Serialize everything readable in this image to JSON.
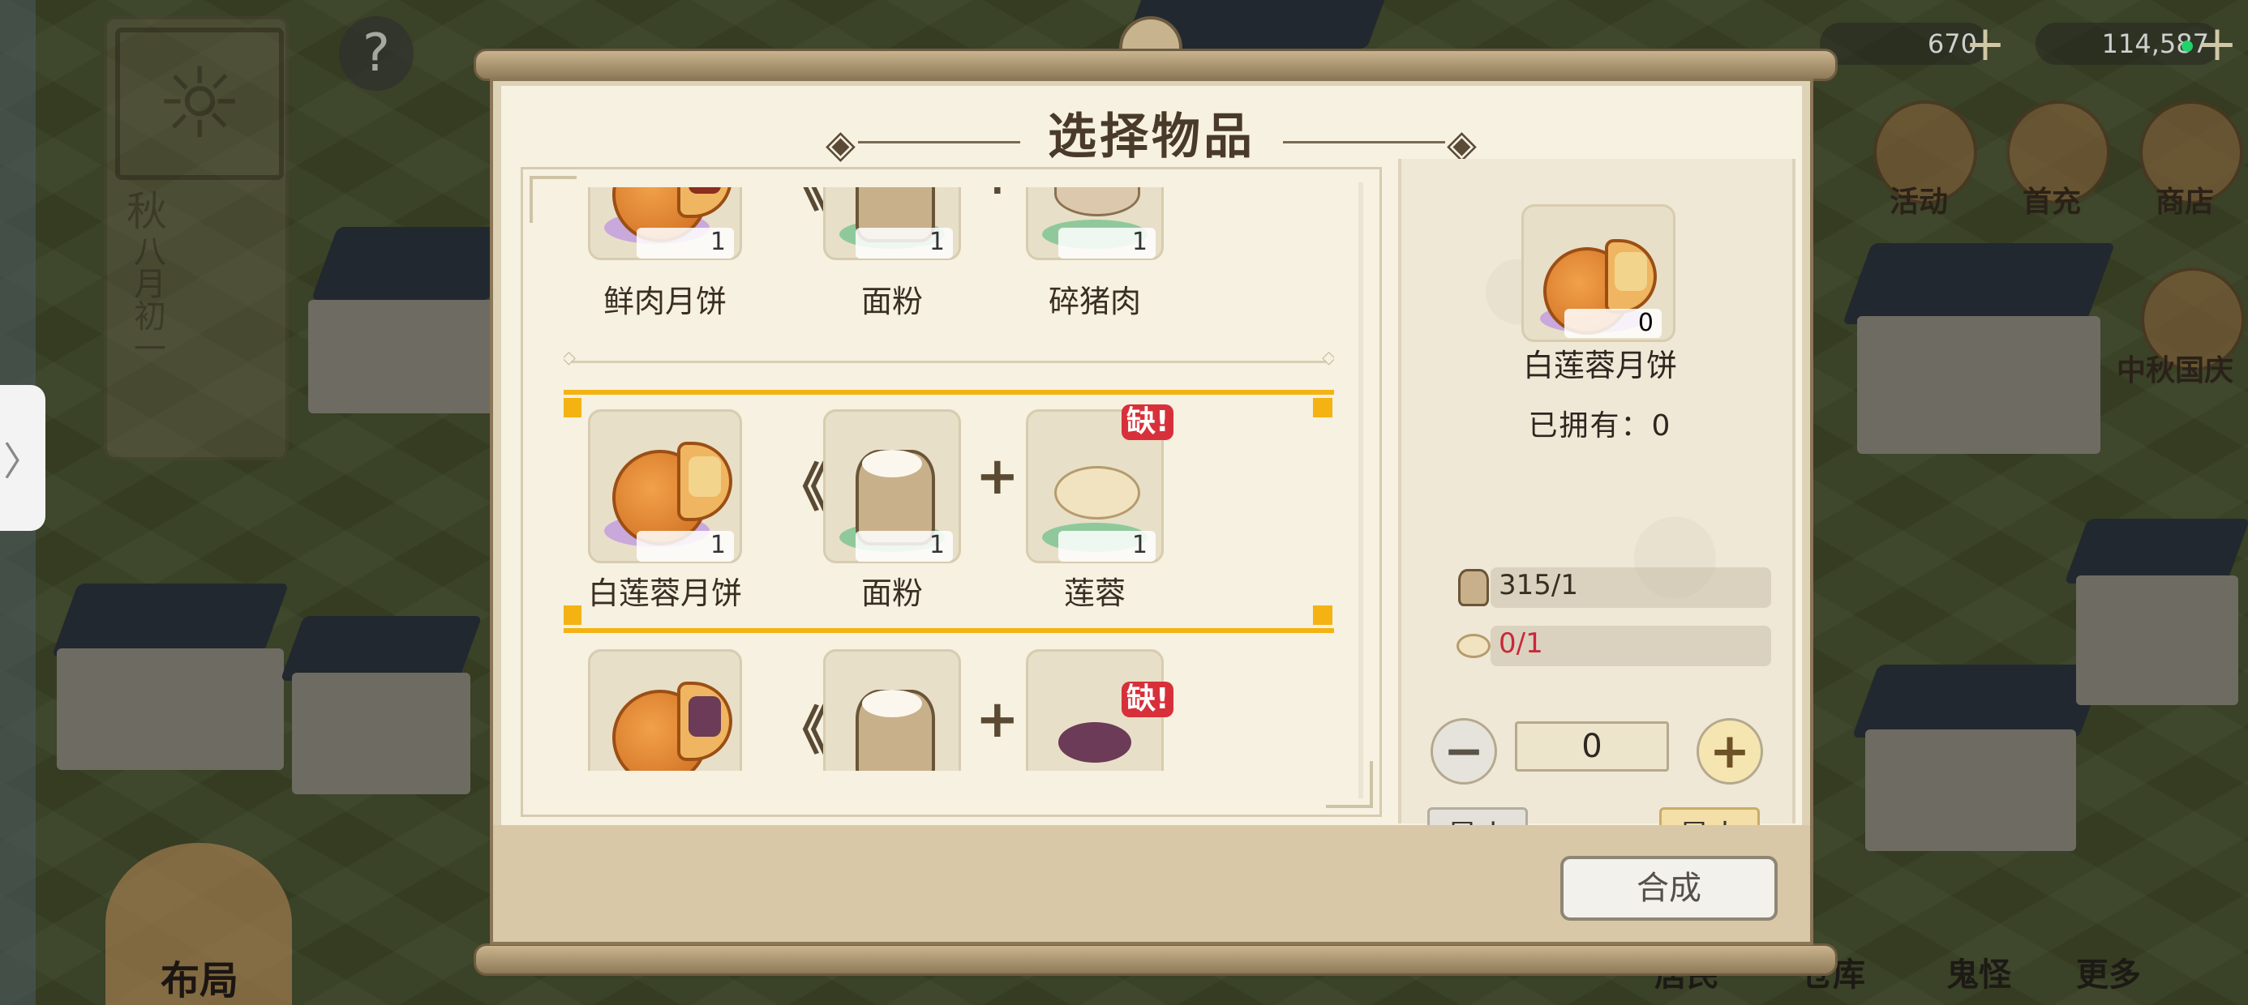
{
  "hud": {
    "help": "?",
    "season": "秋",
    "date": "八月初一",
    "layout_label": "布局",
    "currency_1": "670",
    "currency_2": "114,587",
    "plus": "+",
    "right_menu": [
      "活动",
      "首充",
      "商店"
    ],
    "event_label": "中秋国庆",
    "bottom_nav": [
      "鬼怪",
      "居民",
      "仓库",
      "更多"
    ],
    "side_tab_glyph": "〉"
  },
  "dialog": {
    "title": "选择物品",
    "recipes": [
      {
        "product": {
          "name": "鲜肉月饼",
          "qty": "1"
        },
        "ingredients": [
          {
            "name": "面粉",
            "qty": "1",
            "lacking": false
          },
          {
            "name": "碎猪肉",
            "qty": "1",
            "lacking": true
          }
        ]
      },
      {
        "product": {
          "name": "白莲蓉月饼",
          "qty": "1"
        },
        "ingredients": [
          {
            "name": "面粉",
            "qty": "1",
            "lacking": false
          },
          {
            "name": "莲蓉",
            "qty": "1",
            "lacking": true
          }
        ],
        "selected": true
      },
      {
        "product": {
          "name": "",
          "qty": ""
        },
        "ingredients": [
          {
            "name": "",
            "qty": "",
            "lacking": false
          },
          {
            "name": "",
            "qty": "",
            "lacking": true
          }
        ]
      }
    ],
    "lack_label": "缺!",
    "plus_symbol": "+",
    "arrow_symbol": "《"
  },
  "detail": {
    "name": "白莲蓉月饼",
    "qty": "0",
    "owned": "已拥有：0",
    "requirements": [
      {
        "icon": "flour-bag-icon",
        "text": "315/1",
        "color": "#3a2e22"
      },
      {
        "icon": "lotus-paste-icon",
        "text": "0/1",
        "color": "#c8283a"
      }
    ],
    "stepper_value": "0",
    "minus": "−",
    "plus": "+",
    "min_label": "最小",
    "max_label": "最大",
    "craft_label": "合成"
  },
  "colors": {
    "selection": "#f4b312",
    "lack_badge": "#d8303a",
    "panel_bg": "#f6f1e1"
  }
}
